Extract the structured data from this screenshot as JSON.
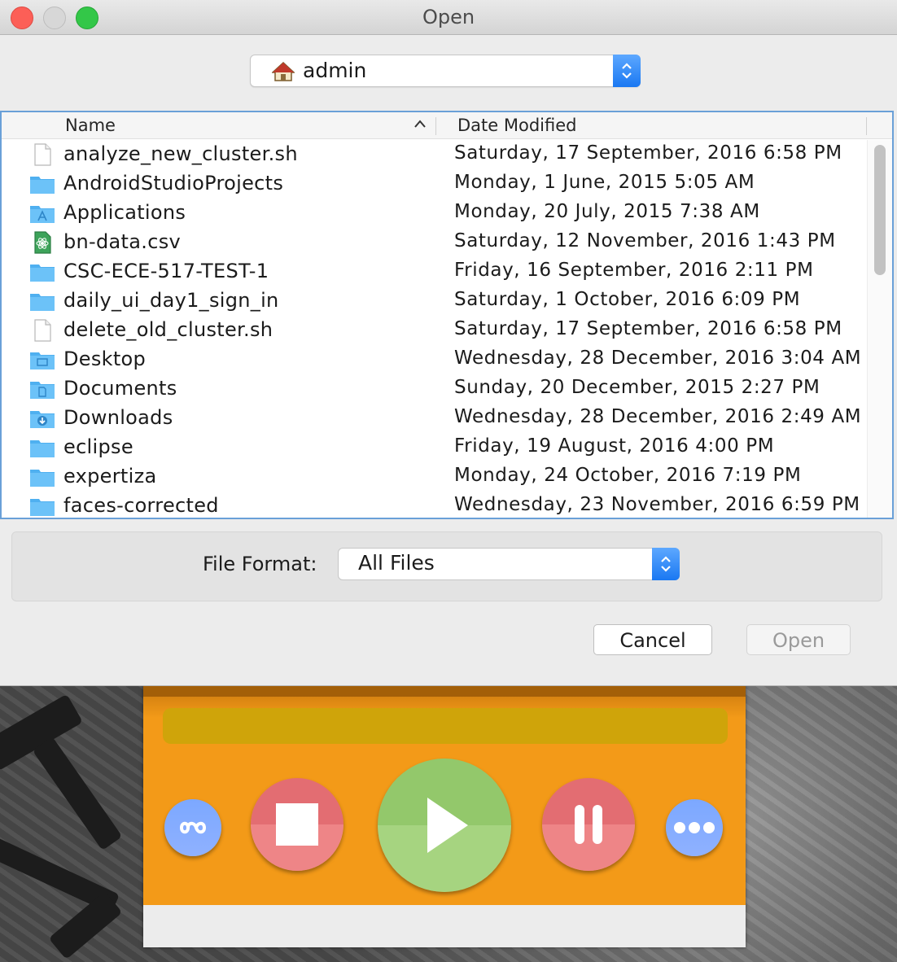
{
  "dialog": {
    "title": "Open",
    "location": "admin",
    "columns": {
      "name": "Name",
      "date": "Date Modified"
    },
    "files": [
      {
        "name": "analyze_new_cluster.sh",
        "date": "Saturday, 17 September, 2016 6:58 PM",
        "icon": "document-icon"
      },
      {
        "name": "AndroidStudioProjects",
        "date": "Monday, 1 June, 2015 5:05 AM",
        "icon": "folder-icon"
      },
      {
        "name": "Applications",
        "date": "Monday, 20 July, 2015 7:38 AM",
        "icon": "applications-folder-icon"
      },
      {
        "name": "bn-data.csv",
        "date": "Saturday, 12 November, 2016 1:43 PM",
        "icon": "csv-file-icon"
      },
      {
        "name": "CSC-ECE-517-TEST-1",
        "date": "Friday, 16 September, 2016 2:11 PM",
        "icon": "folder-icon"
      },
      {
        "name": "daily_ui_day1_sign_in",
        "date": "Saturday, 1 October, 2016 6:09 PM",
        "icon": "folder-icon"
      },
      {
        "name": "delete_old_cluster.sh",
        "date": "Saturday, 17 September, 2016 6:58 PM",
        "icon": "document-icon"
      },
      {
        "name": "Desktop",
        "date": "Wednesday, 28 December, 2016 3:04 AM",
        "icon": "desktop-folder-icon"
      },
      {
        "name": "Documents",
        "date": "Sunday, 20 December, 2015 2:27 PM",
        "icon": "documents-folder-icon"
      },
      {
        "name": "Downloads",
        "date": "Wednesday, 28 December, 2016 2:49 AM",
        "icon": "downloads-folder-icon"
      },
      {
        "name": "eclipse",
        "date": "Friday, 19 August, 2016 4:00 PM",
        "icon": "folder-icon"
      },
      {
        "name": "expertiza",
        "date": "Monday, 24 October, 2016 7:19 PM",
        "icon": "folder-icon"
      },
      {
        "name": "faces-corrected",
        "date": "Wednesday, 23 November, 2016 6:59 PM",
        "icon": "folder-icon"
      }
    ],
    "format_label": "File Format:",
    "format_value": "All Files",
    "cancel_label": "Cancel",
    "open_label": "Open"
  },
  "colors": {
    "folder": "#5bb8f5",
    "accent": "#1a78f2",
    "player_orange": "#f39a18",
    "play_green": "#a6d480",
    "stop_red": "#ee8587",
    "side_blue": "#8fb1ff"
  }
}
